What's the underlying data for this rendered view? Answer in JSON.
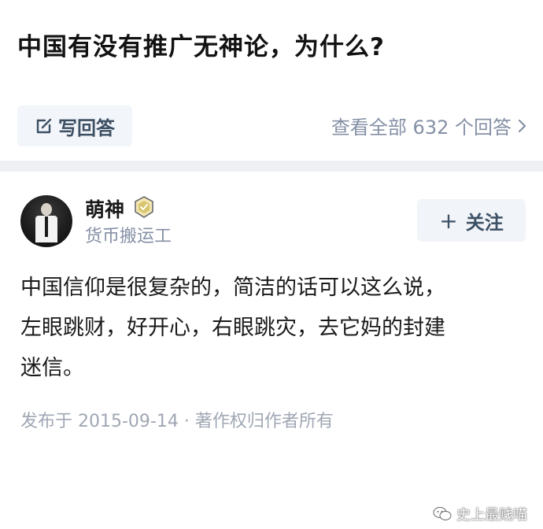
{
  "question": {
    "title": "中国有没有推广无神论，为什么?"
  },
  "actions": {
    "write_answer_label": "写回答",
    "view_all_label": "查看全部 632 个回答"
  },
  "author": {
    "name": "萌神",
    "bio": "货币搬运工",
    "follow_label": "关注"
  },
  "answer": {
    "lines": [
      "中国信仰是很复杂的，简洁的话可以这么说，",
      "左眼跳财，好开心，右眼跳灾，去它妈的封建",
      "迷信。"
    ]
  },
  "meta": {
    "text": "发布于 2015-09-14 · 著作权归作者所有"
  },
  "watermark": {
    "text": "史上最贱喵"
  },
  "icons": {
    "write": "edit-icon",
    "view_all": "chevron-right-icon",
    "follow": "plus-icon",
    "badge": "verified-badge-icon",
    "watermark": "wechat-icon"
  },
  "colors": {
    "primary_text": "#121212",
    "muted_text": "#8590a6",
    "button_bg": "#f2f5f9",
    "button_text": "#3d4f63",
    "divider": "#eef0f3"
  }
}
